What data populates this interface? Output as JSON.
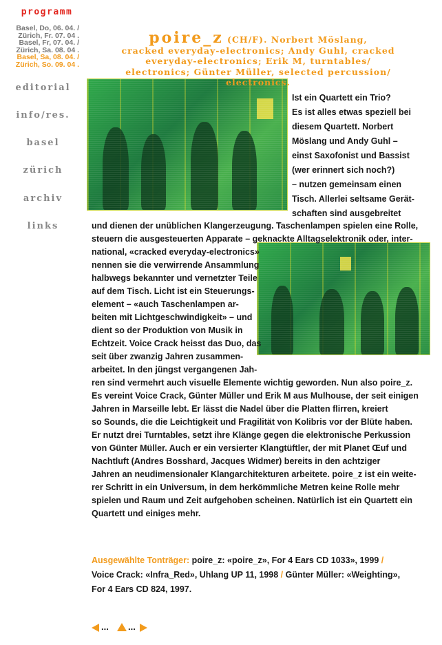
{
  "nav": {
    "title": "programm",
    "dates": [
      {
        "label": "Basel, Do, 06. 04. /",
        "active": false
      },
      {
        "label": "Zürich, Fr. 07. 04 .",
        "active": false
      },
      {
        "label": "Basel, Fr, 07. 04. /",
        "active": false
      },
      {
        "label": "Zürich, Sa. 08. 04 .",
        "active": false
      },
      {
        "label": "Basel, Sa, 08. 04. /",
        "active": true
      },
      {
        "label": "Zürich, So. 09. 04 .",
        "active": true
      }
    ],
    "menu": [
      "editorial",
      "info/res.",
      "basel",
      "zürich",
      "archiv",
      "links"
    ]
  },
  "header": {
    "title_main": "poire_z",
    "title_lines": [
      " (CH/F). Norbert Möslang,",
      "cracked everyday-electronics; Andy Guhl, cracked",
      "everyday-electronics; Erik M, turntables/",
      "electronics; Günter Müller, selected percussion/",
      "electronics."
    ]
  },
  "article": {
    "lines": [
      "Ist ein Quartett ein Trio?",
      "Es ist alles etwas speziell bei",
      "diesem Quartett. Norbert",
      "Möslang und Andy Guhl –",
      "einst Saxofonist und Bassist",
      "(wer erinnert sich noch?)",
      "– nutzen gemeinsam einen",
      "Tisch. Allerlei seltsame Gerät-",
      "schaften sind ausgebreitet",
      "und dienen der unüblichen Klangerzeugung. Taschenlampen spielen eine Rolle,",
      "steuern die ausgesteuerten Apparate – geknackte Alltagselektronik oder, inter-",
      "national, «cracked everyday-electronics»",
      "nennen sie die verwirrende Ansammlung",
      "halbwegs bekannter und vernetzter Teile",
      "auf dem Tisch. Licht ist ein Steuerungs-",
      "element – «auch Taschenlampen ar-",
      "beiten mit Lichtgeschwindigkeit» – und",
      "dient so der Produktion von Musik in",
      "Echtzeit. Voice Crack heisst das Duo, das",
      "seit über zwanzig Jahren zusammen-",
      "arbeitet. In den jüngst vergangenen Jah-",
      "ren sind vermehrt auch visuelle Elemente wichtig geworden. Nun also poire_z.",
      "Es vereint Voice Crack, Günter Müller und Erik M aus Mulhouse, der seit einigen",
      "Jahren in Marseille lebt. Er lässt die Nadel über die Platten flirren, kreiert",
      "so Sounds, die die Leichtigkeit und Fragilität von Kolibris vor der Blüte haben.",
      "Er nutzt drei Turntables, setzt ihre Klänge gegen die elektronische Perkussion",
      "von Günter Müller. Auch er ein versierter Klangtüftler, der mit Planet Œuf und",
      "Nachtluft (Andres Bosshard, Jacques Widmer) bereits in den achtziger",
      "Jahren an neudimensionaler Klangarchitekturen arbeitete. poire_z ist ein weite-",
      "rer Schritt in ein Universum, in dem herkömmliche Metren keine Rolle mehr",
      "spielen und Raum und Zeit aufgehoben scheinen. Natürlich ist ein Quartett ein",
      "Quartett und einiges mehr."
    ]
  },
  "discography": {
    "label": "Ausgewählte Tonträger:",
    "part1": " poire_z: «poire_z», For 4 Ears CD 1033», 1999 ",
    "sep": "/",
    "part2": " Voice Crack: «Infra_Red», Uhlang UP 11, 1998 ",
    "part3": " Günter Müller: «Weighting»,",
    "part4": "For 4 Ears CD 824, 1997."
  },
  "pager": {
    "dots": "..."
  },
  "colors": {
    "accent": "#f29b1d",
    "nav_title": "#e2261f",
    "nav_text": "#888888",
    "photo_tint": "#2fa84a"
  },
  "icons": [
    "arrow-left-icon",
    "arrow-up-icon",
    "arrow-right-icon"
  ]
}
